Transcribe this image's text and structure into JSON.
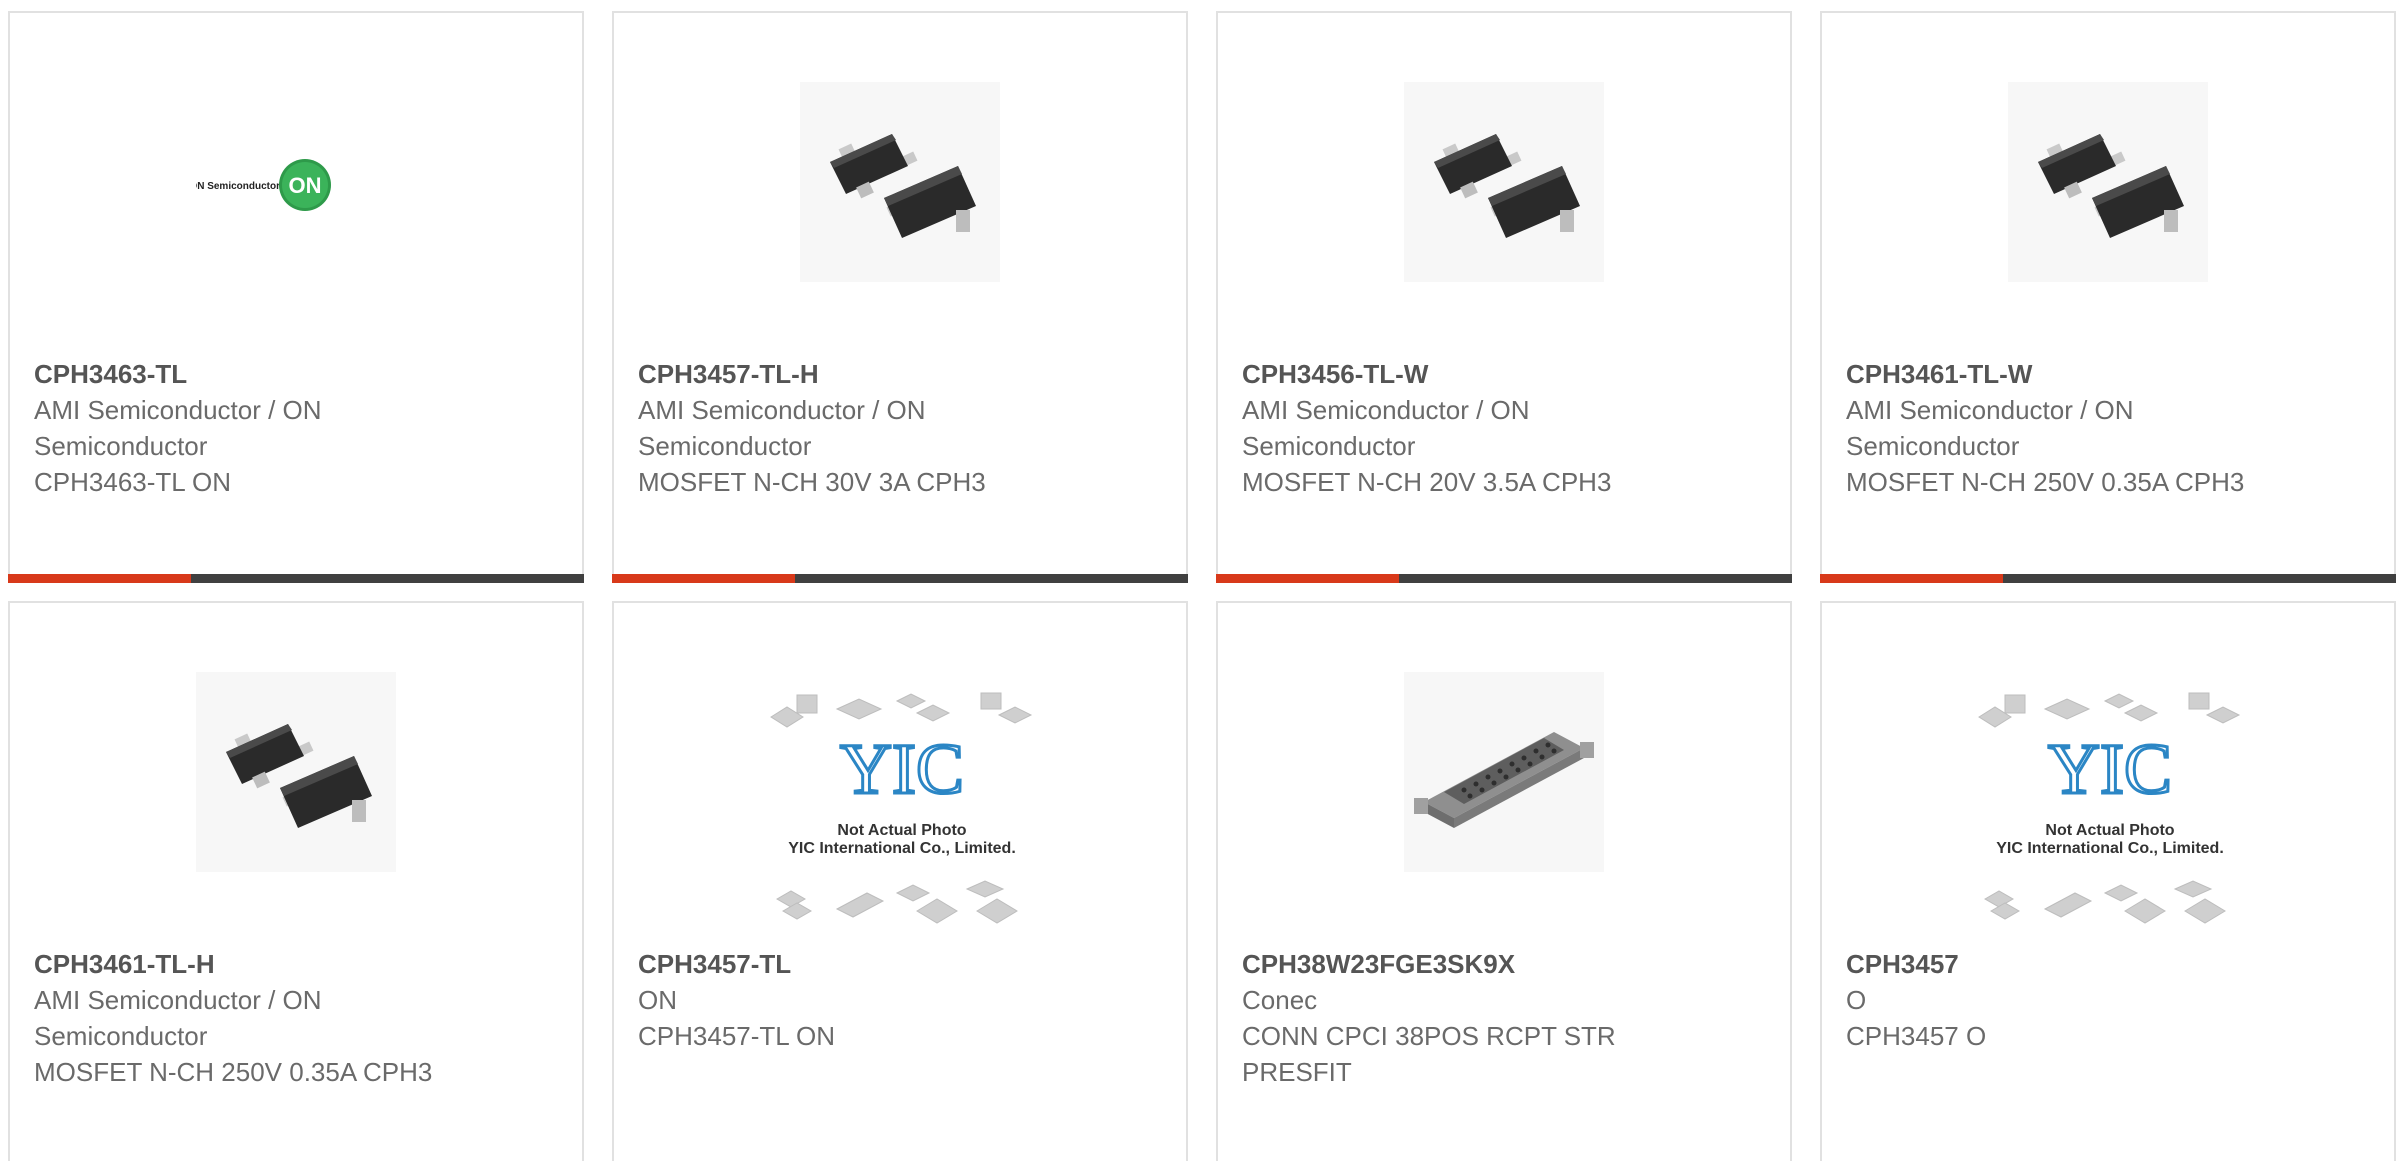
{
  "products": [
    {
      "part_number": "CPH3463-TL",
      "manufacturer": "AMI Semiconductor / ON Semiconductor",
      "description": "CPH3463-TL ON",
      "image": "on-semiconductor-logo",
      "logo_text": "ON Semiconductor",
      "logo_badge": "ON"
    },
    {
      "part_number": "CPH3457-TL-H",
      "manufacturer": "AMI Semiconductor / ON Semiconductor",
      "description": "MOSFET N-CH 30V 3A CPH3",
      "image": "sot23-transistor-photo"
    },
    {
      "part_number": "CPH3456-TL-W",
      "manufacturer": "AMI Semiconductor / ON Semiconductor",
      "description": "MOSFET N-CH 20V 3.5A CPH3",
      "image": "sot23-transistor-photo"
    },
    {
      "part_number": "CPH3461-TL-W",
      "manufacturer": "AMI Semiconductor / ON Semiconductor",
      "description": "MOSFET N-CH 250V 0.35A CPH3",
      "image": "sot23-transistor-photo"
    },
    {
      "part_number": "CPH3461-TL-H",
      "manufacturer": "AMI Semiconductor / ON Semiconductor",
      "description": "MOSFET N-CH 250V 0.35A CPH3",
      "image": "sot23-transistor-photo"
    },
    {
      "part_number": "CPH3457-TL",
      "manufacturer": "ON",
      "description": "CPH3457-TL ON",
      "image": "not-actual-photo-placeholder",
      "placeholder_logo": "YIC",
      "placeholder_line1": "Not Actual Photo",
      "placeholder_line2": "YIC International Co., Limited."
    },
    {
      "part_number": "CPH38W23FGE3SK9X",
      "manufacturer": "Conec",
      "description": "CONN CPCI 38POS RCPT STR PRESFIT",
      "image": "connector-photo"
    },
    {
      "part_number": "CPH3457",
      "manufacturer": "O",
      "description": "CPH3457 O",
      "image": "not-actual-photo-placeholder",
      "placeholder_logo": "YIC",
      "placeholder_line1": "Not Actual Photo",
      "placeholder_line2": "YIC International Co., Limited."
    }
  ],
  "colors": {
    "accent": "#d8391a",
    "bar": "#404040",
    "border": "#e1e1e1",
    "part_text": "#555555",
    "body_text": "#6a6a6a"
  }
}
